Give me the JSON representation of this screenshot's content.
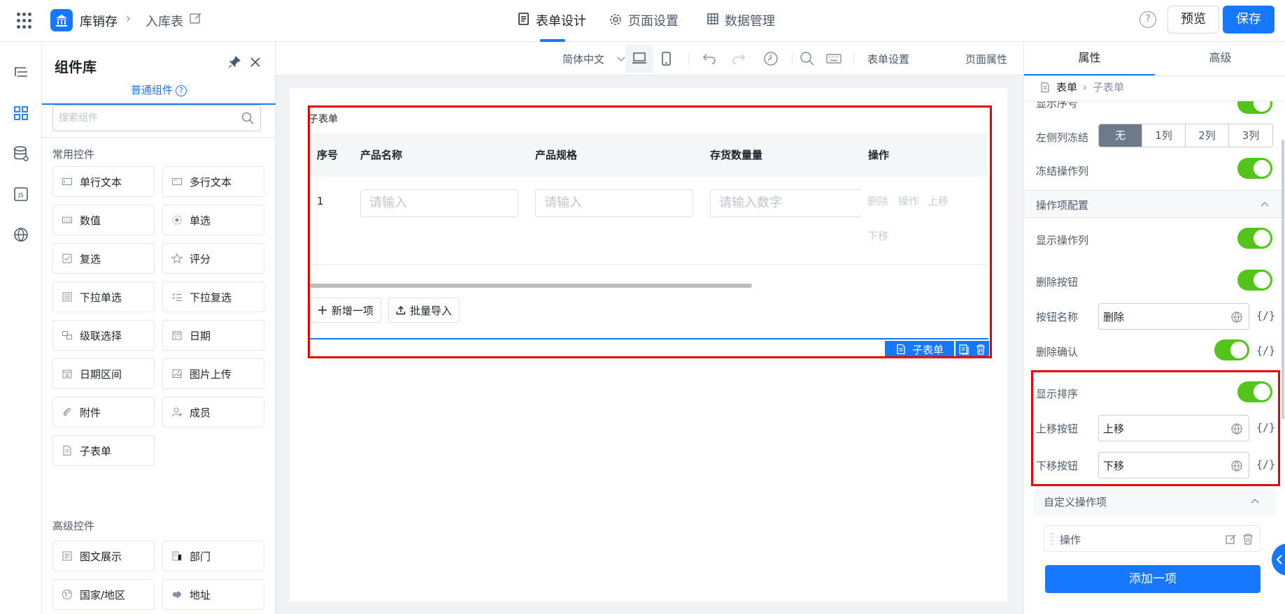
{
  "header": {
    "app_name": "库销存",
    "form_name": "入库表",
    "tabs": [
      {
        "label": "表单设计",
        "active": true
      },
      {
        "label": "页面设置",
        "active": false
      },
      {
        "label": "数据管理",
        "active": false
      }
    ],
    "help": "?",
    "preview_label": "预览",
    "save_label": "保存"
  },
  "library": {
    "title": "组件库",
    "tab_label": "普通组件",
    "search_placeholder": "搜索组件",
    "group_common": "常用控件",
    "common_items": [
      "单行文本",
      "多行文本",
      "数值",
      "单选",
      "复选",
      "评分",
      "下拉单选",
      "下拉复选",
      "级联选择",
      "日期",
      "日期区间",
      "图片上传",
      "附件",
      "成员",
      "子表单"
    ],
    "group_advanced": "高级控件",
    "advanced_items": [
      "图文展示",
      "部门",
      "国家/地区",
      "地址"
    ]
  },
  "toolbar": {
    "language": "简体中文",
    "form_settings": "表单设置",
    "page_properties": "页面属性"
  },
  "subform": {
    "title": "子表单",
    "columns": [
      "序号",
      "产品名称",
      "产品规格",
      "存货数量量",
      "操作"
    ],
    "row": {
      "index": "1",
      "placeholder_name": "请输入",
      "placeholder_spec": "请输入",
      "placeholder_qty": "请输入数字",
      "ops": [
        "删除",
        "操作",
        "上移",
        "下移"
      ]
    },
    "add_label": "新增一项",
    "import_label": "批量导入",
    "tag_label": "子表单"
  },
  "panel": {
    "tabs": [
      "属性",
      "高级"
    ],
    "crumb_form": "表单",
    "crumb_sub": "子表单",
    "show_index_label": "显示序号",
    "freeze_left_label": "左侧列冻结",
    "freeze_options": [
      "无",
      "1列",
      "2列",
      "3列"
    ],
    "freeze_ops_label": "冻结操作列",
    "section_ops": "操作项配置",
    "show_ops_label": "显示操作列",
    "delete_btn_label": "删除按钮",
    "btn_name_label": "按钮名称",
    "btn_name_value": "删除",
    "delete_confirm_label": "删除确认",
    "show_sort_label": "显示排序",
    "move_up_label": "上移按钮",
    "move_up_value": "上移",
    "move_down_label": "下移按钮",
    "move_down_value": "下移",
    "expr": "{/}",
    "section_custom": "自定义操作项",
    "custom_item": "操作",
    "add_item_label": "添加一项"
  },
  "colors": {
    "accent": "#1677ff",
    "toggle_on": "#52c41a",
    "highlight": "#e60000"
  }
}
